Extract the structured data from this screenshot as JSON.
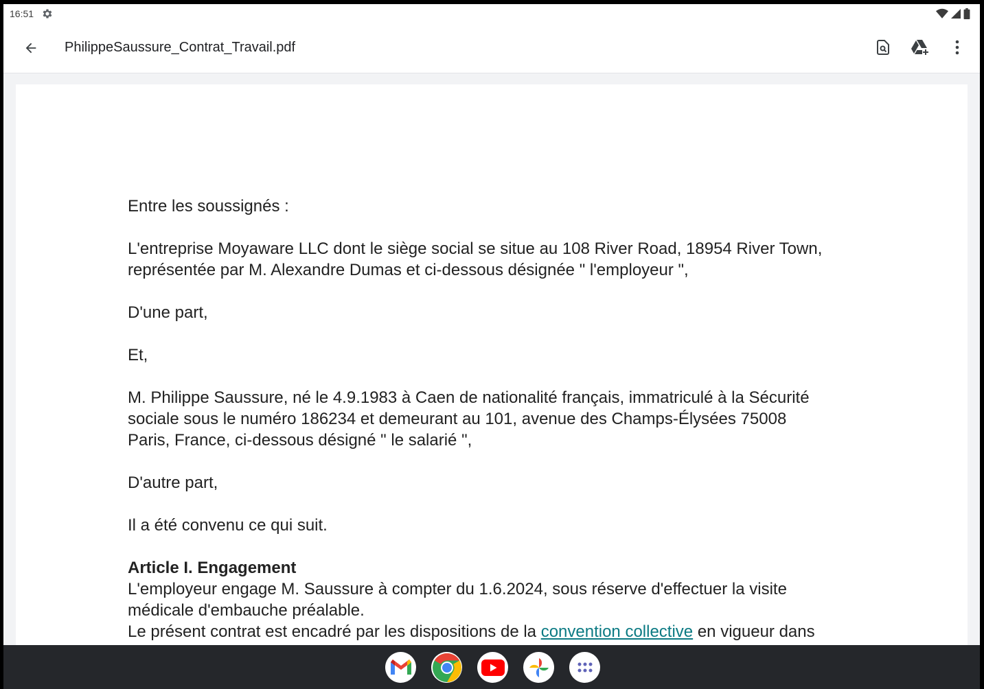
{
  "status_bar": {
    "time": "16:51",
    "icons": [
      "settings-gear-icon",
      "wifi-icon",
      "signal-icon",
      "battery-icon"
    ]
  },
  "app_bar": {
    "title": "PhilippeSaussure_Contrat_Travail.pdf",
    "actions": [
      "find-in-page-icon",
      "add-to-drive-icon",
      "more-options-icon"
    ]
  },
  "document": {
    "intro": "Entre les soussignés :",
    "employer_line1": "L'entreprise Moyaware LLC dont le siège social se situe au 108 River Road, 18954 River Town,",
    "employer_line2": "représentée par M. Alexandre Dumas et ci-dessous désignée \" l'employeur \",",
    "dune_part": "D'une part,",
    "et": "Et,",
    "employee_line1": "M. Philippe Saussure, né le 4.9.1983 à Caen de nationalité français, immatriculé à la Sécurité",
    "employee_line2": "sociale sous le numéro 186234 et demeurant au 101, avenue des Champs-Élysées 75008",
    "employee_line3": "Paris, France, ci-dessous désigné \" le salarié \",",
    "dautre_part": "D'autre part,",
    "convenu": "Il a été convenu ce qui suit.",
    "article1_heading": "Article I. Engagement",
    "article1_line1": "L'employeur engage M. Saussure à compter du 1.6.2024, sous réserve d'effectuer la visite",
    "article1_line2": "médicale d'embauche préalable.",
    "article1_line3_before": "Le présent contrat est encadré par les dispositions de la ",
    "article1_link": "convention collective",
    "article1_line3_after": " en vigueur dans"
  },
  "taskbar": {
    "apps": [
      "gmail-icon",
      "chrome-icon",
      "youtube-icon",
      "photos-icon",
      "app-drawer-icon"
    ]
  },
  "colors": {
    "link": "#0b7a83",
    "taskbar": "#25272b",
    "page_bg": "#f2f3f5"
  }
}
